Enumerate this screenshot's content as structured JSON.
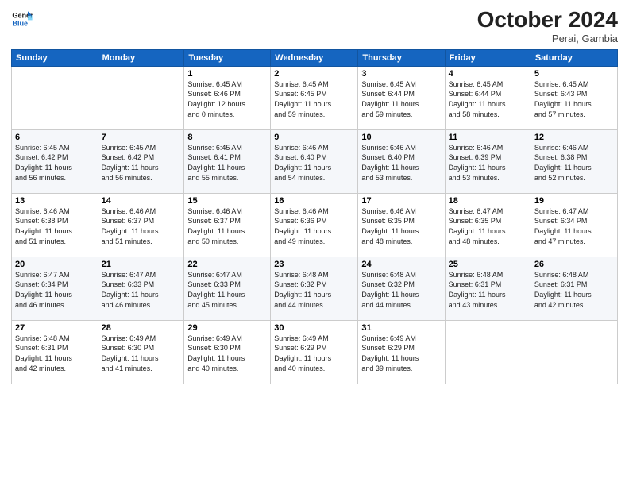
{
  "logo": {
    "line1": "General",
    "line2": "Blue"
  },
  "title": "October 2024",
  "subtitle": "Perai, Gambia",
  "days_header": [
    "Sunday",
    "Monday",
    "Tuesday",
    "Wednesday",
    "Thursday",
    "Friday",
    "Saturday"
  ],
  "weeks": [
    [
      {
        "day": "",
        "info": ""
      },
      {
        "day": "",
        "info": ""
      },
      {
        "day": "1",
        "info": "Sunrise: 6:45 AM\nSunset: 6:46 PM\nDaylight: 12 hours\nand 0 minutes."
      },
      {
        "day": "2",
        "info": "Sunrise: 6:45 AM\nSunset: 6:45 PM\nDaylight: 11 hours\nand 59 minutes."
      },
      {
        "day": "3",
        "info": "Sunrise: 6:45 AM\nSunset: 6:44 PM\nDaylight: 11 hours\nand 59 minutes."
      },
      {
        "day": "4",
        "info": "Sunrise: 6:45 AM\nSunset: 6:44 PM\nDaylight: 11 hours\nand 58 minutes."
      },
      {
        "day": "5",
        "info": "Sunrise: 6:45 AM\nSunset: 6:43 PM\nDaylight: 11 hours\nand 57 minutes."
      }
    ],
    [
      {
        "day": "6",
        "info": "Sunrise: 6:45 AM\nSunset: 6:42 PM\nDaylight: 11 hours\nand 56 minutes."
      },
      {
        "day": "7",
        "info": "Sunrise: 6:45 AM\nSunset: 6:42 PM\nDaylight: 11 hours\nand 56 minutes."
      },
      {
        "day": "8",
        "info": "Sunrise: 6:45 AM\nSunset: 6:41 PM\nDaylight: 11 hours\nand 55 minutes."
      },
      {
        "day": "9",
        "info": "Sunrise: 6:46 AM\nSunset: 6:40 PM\nDaylight: 11 hours\nand 54 minutes."
      },
      {
        "day": "10",
        "info": "Sunrise: 6:46 AM\nSunset: 6:40 PM\nDaylight: 11 hours\nand 53 minutes."
      },
      {
        "day": "11",
        "info": "Sunrise: 6:46 AM\nSunset: 6:39 PM\nDaylight: 11 hours\nand 53 minutes."
      },
      {
        "day": "12",
        "info": "Sunrise: 6:46 AM\nSunset: 6:38 PM\nDaylight: 11 hours\nand 52 minutes."
      }
    ],
    [
      {
        "day": "13",
        "info": "Sunrise: 6:46 AM\nSunset: 6:38 PM\nDaylight: 11 hours\nand 51 minutes."
      },
      {
        "day": "14",
        "info": "Sunrise: 6:46 AM\nSunset: 6:37 PM\nDaylight: 11 hours\nand 51 minutes."
      },
      {
        "day": "15",
        "info": "Sunrise: 6:46 AM\nSunset: 6:37 PM\nDaylight: 11 hours\nand 50 minutes."
      },
      {
        "day": "16",
        "info": "Sunrise: 6:46 AM\nSunset: 6:36 PM\nDaylight: 11 hours\nand 49 minutes."
      },
      {
        "day": "17",
        "info": "Sunrise: 6:46 AM\nSunset: 6:35 PM\nDaylight: 11 hours\nand 48 minutes."
      },
      {
        "day": "18",
        "info": "Sunrise: 6:47 AM\nSunset: 6:35 PM\nDaylight: 11 hours\nand 48 minutes."
      },
      {
        "day": "19",
        "info": "Sunrise: 6:47 AM\nSunset: 6:34 PM\nDaylight: 11 hours\nand 47 minutes."
      }
    ],
    [
      {
        "day": "20",
        "info": "Sunrise: 6:47 AM\nSunset: 6:34 PM\nDaylight: 11 hours\nand 46 minutes."
      },
      {
        "day": "21",
        "info": "Sunrise: 6:47 AM\nSunset: 6:33 PM\nDaylight: 11 hours\nand 46 minutes."
      },
      {
        "day": "22",
        "info": "Sunrise: 6:47 AM\nSunset: 6:33 PM\nDaylight: 11 hours\nand 45 minutes."
      },
      {
        "day": "23",
        "info": "Sunrise: 6:48 AM\nSunset: 6:32 PM\nDaylight: 11 hours\nand 44 minutes."
      },
      {
        "day": "24",
        "info": "Sunrise: 6:48 AM\nSunset: 6:32 PM\nDaylight: 11 hours\nand 44 minutes."
      },
      {
        "day": "25",
        "info": "Sunrise: 6:48 AM\nSunset: 6:31 PM\nDaylight: 11 hours\nand 43 minutes."
      },
      {
        "day": "26",
        "info": "Sunrise: 6:48 AM\nSunset: 6:31 PM\nDaylight: 11 hours\nand 42 minutes."
      }
    ],
    [
      {
        "day": "27",
        "info": "Sunrise: 6:48 AM\nSunset: 6:31 PM\nDaylight: 11 hours\nand 42 minutes."
      },
      {
        "day": "28",
        "info": "Sunrise: 6:49 AM\nSunset: 6:30 PM\nDaylight: 11 hours\nand 41 minutes."
      },
      {
        "day": "29",
        "info": "Sunrise: 6:49 AM\nSunset: 6:30 PM\nDaylight: 11 hours\nand 40 minutes."
      },
      {
        "day": "30",
        "info": "Sunrise: 6:49 AM\nSunset: 6:29 PM\nDaylight: 11 hours\nand 40 minutes."
      },
      {
        "day": "31",
        "info": "Sunrise: 6:49 AM\nSunset: 6:29 PM\nDaylight: 11 hours\nand 39 minutes."
      },
      {
        "day": "",
        "info": ""
      },
      {
        "day": "",
        "info": ""
      }
    ]
  ]
}
